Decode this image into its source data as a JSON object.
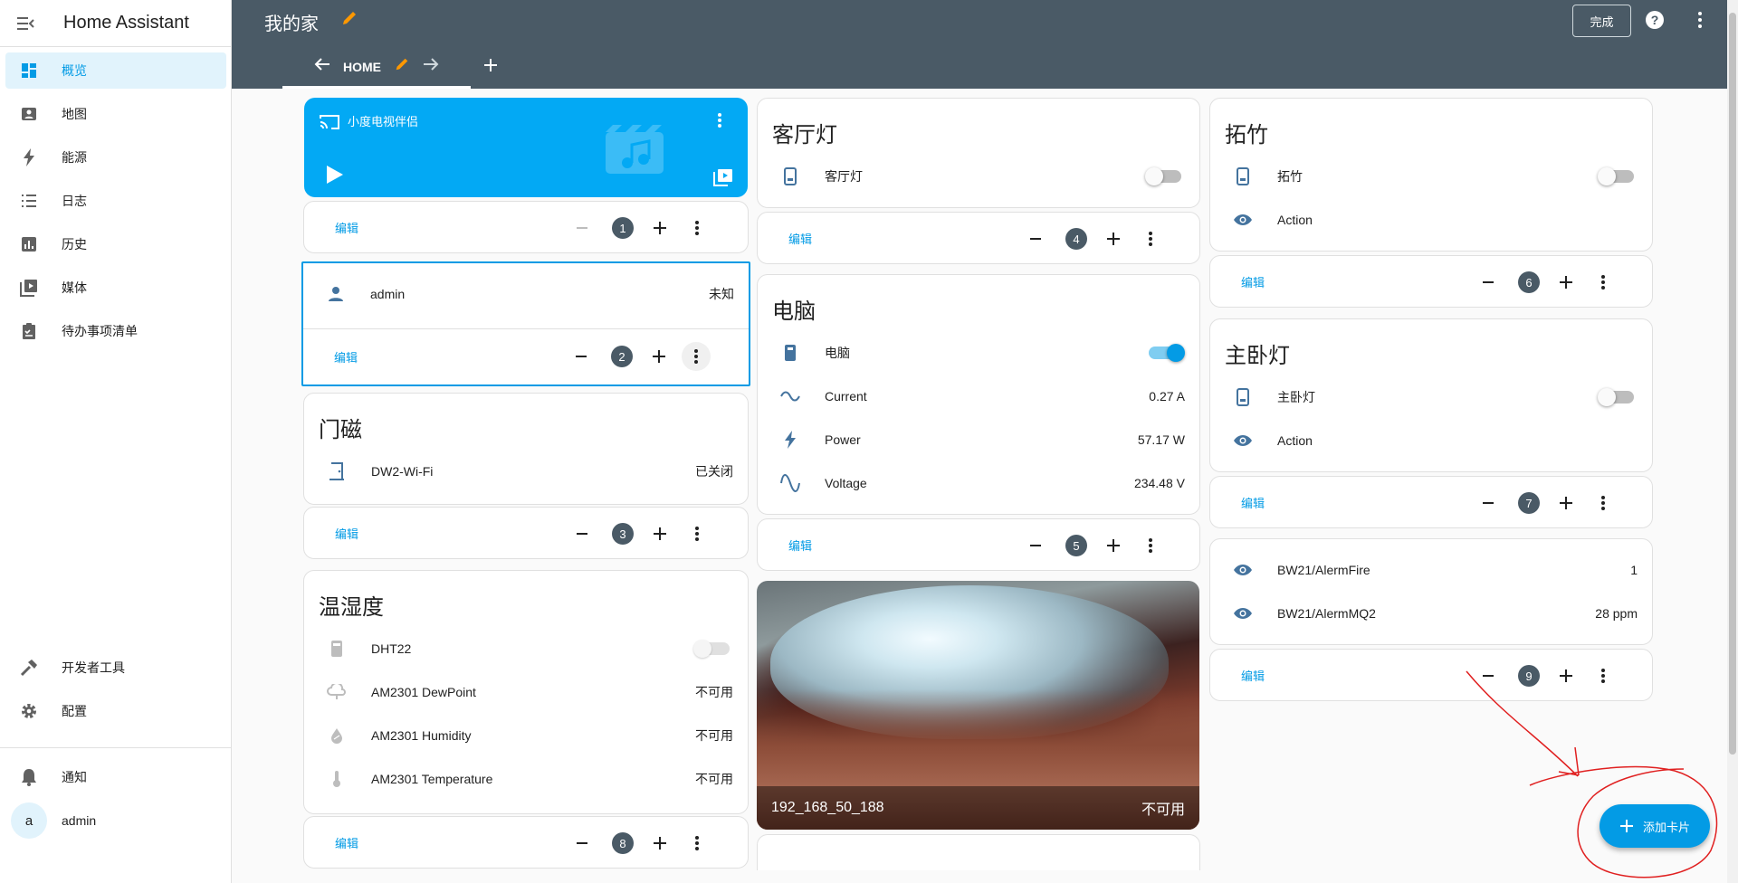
{
  "app": {
    "title": "Home Assistant"
  },
  "sidebar": {
    "items": [
      {
        "label": "概览",
        "icon": "dashboard-icon"
      },
      {
        "label": "地图",
        "icon": "map-icon"
      },
      {
        "label": "能源",
        "icon": "energy-icon"
      },
      {
        "label": "日志",
        "icon": "logbook-icon"
      },
      {
        "label": "历史",
        "icon": "history-icon"
      },
      {
        "label": "媒体",
        "icon": "media-icon"
      },
      {
        "label": "待办事项清单",
        "icon": "todo-icon"
      }
    ],
    "dev_tools": "开发者工具",
    "settings": "配置",
    "notifications": "通知",
    "user": {
      "name": "admin",
      "initial": "a"
    }
  },
  "header": {
    "title": "我的家",
    "done": "完成",
    "tab": "HOME"
  },
  "cards": {
    "media": {
      "name": "小度电视伴侣",
      "edit": "编辑",
      "position": "1"
    },
    "admin": {
      "name": "admin",
      "state": "未知",
      "edit": "编辑",
      "position": "2"
    },
    "door": {
      "title": "门磁",
      "entity": "DW2-Wi-Fi",
      "state": "已关闭",
      "edit": "编辑",
      "position": "3"
    },
    "livingroom": {
      "title": "客厅灯",
      "entity": "客厅灯",
      "toggle": "off",
      "edit": "编辑",
      "position": "4"
    },
    "pc": {
      "title": "电脑",
      "rows": [
        {
          "name": "电脑",
          "value": "",
          "toggle": "on"
        },
        {
          "name": "Current",
          "value": "0.27 A"
        },
        {
          "name": "Power",
          "value": "57.17 W"
        },
        {
          "name": "Voltage",
          "value": "234.48 V"
        }
      ],
      "edit": "编辑",
      "position": "5"
    },
    "tuozhu": {
      "title": "拓竹",
      "entity": "拓竹",
      "toggle": "off",
      "action": "Action",
      "edit": "编辑",
      "position": "6"
    },
    "bedroom": {
      "title": "主卧灯",
      "entity": "主卧灯",
      "toggle": "off",
      "action": "Action",
      "edit": "编辑",
      "position": "7"
    },
    "sensors": {
      "rows": [
        {
          "name": "BW21/AlermFire",
          "value": "1"
        },
        {
          "name": "BW21/AlermMQ2",
          "value": "28 ppm"
        }
      ],
      "edit": "编辑",
      "position": "9"
    },
    "climate": {
      "title": "温湿度",
      "rows": [
        {
          "name": "DHT22",
          "value": ""
        },
        {
          "name": "AM2301 DewPoint",
          "value": "不可用"
        },
        {
          "name": "AM2301 Humidity",
          "value": "不可用"
        },
        {
          "name": "AM2301 Temperature",
          "value": "不可用"
        }
      ],
      "edit": "编辑",
      "position": "8"
    },
    "camera": {
      "name": "192_168_50_188",
      "state": "不可用"
    }
  },
  "fab": {
    "label": "添加卡片"
  },
  "colors": {
    "accent": "#039be5",
    "header": "#4a5a66",
    "media": "#03a9f4",
    "annotation": "#e02020"
  }
}
